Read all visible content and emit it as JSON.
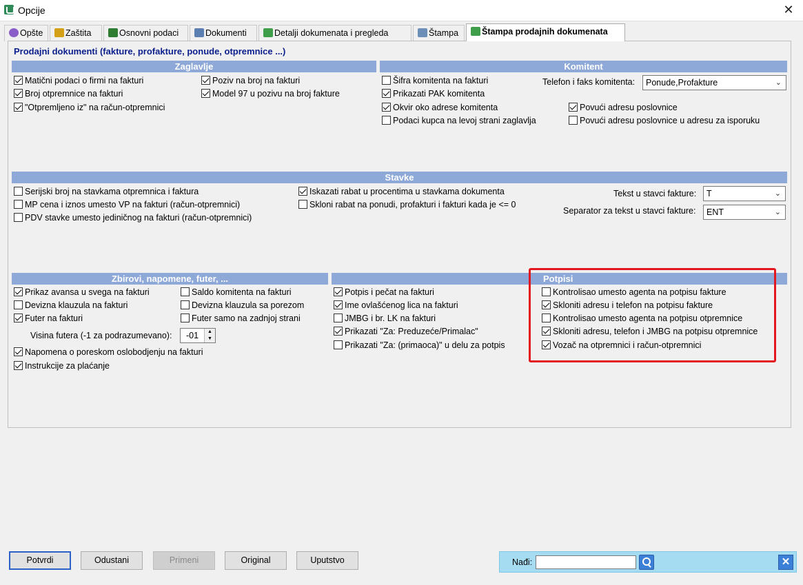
{
  "window": {
    "title": "Opcije",
    "close": "✕"
  },
  "tabs": [
    {
      "label": "Opšte",
      "icon": "gear-icon",
      "color": "#8a5ec9"
    },
    {
      "label": "Zaštita",
      "icon": "lock-icon",
      "color": "#d4a017"
    },
    {
      "label": "Osnovni podaci",
      "icon": "book-icon",
      "color": "#2e7d32"
    },
    {
      "label": "Dokumenti",
      "icon": "document-icon",
      "color": "#5b7fb0"
    },
    {
      "label": "Detalji dokumenata i pregleda",
      "icon": "document-edit-icon",
      "color": "#3e9e4a"
    },
    {
      "label": "Štampa",
      "icon": "printer-icon",
      "color": "#6c8fb8"
    },
    {
      "label": "Štampa prodajnih dokumenata",
      "icon": "printer-icon",
      "color": "#3e9e4a"
    }
  ],
  "group_title": "Prodajni dokumenti (fakture, profakture, ponude, otpremnice ...)",
  "zaglavlje": {
    "header": "Zaglavlje",
    "items": [
      {
        "label": "Matični podaci o firmi na fakturi",
        "checked": true
      },
      {
        "label": "Broj otpremnice na fakturi",
        "checked": true
      },
      {
        "label": "\"Otpremljeno iz\" na račun-otpremnici",
        "checked": true
      },
      {
        "label": "Poziv na broj na fakturi",
        "checked": true
      },
      {
        "label": "Model 97 u pozivu na broj fakture",
        "checked": true
      }
    ]
  },
  "komitent": {
    "header": "Komitent",
    "items": [
      {
        "label": "Šifra komitenta na fakturi",
        "checked": false
      },
      {
        "label": "Prikazati PAK komitenta",
        "checked": true
      },
      {
        "label": "Okvir oko adrese komitenta",
        "checked": true
      },
      {
        "label": "Podaci kupca na levoj strani zaglavlja",
        "checked": false
      },
      {
        "label": "Povući adresu poslovnice",
        "checked": true
      },
      {
        "label": "Povući adresu poslovnice u adresu za isporuku",
        "checked": false
      }
    ],
    "phone_label": "Telefon i faks komitenta:",
    "phone_value": "Ponude,Profakture"
  },
  "stavke": {
    "header": "Stavke",
    "items": [
      {
        "label": "Serijski broj na stavkama otpremnica i faktura",
        "checked": false
      },
      {
        "label": "MP cena i iznos umesto VP na fakturi (račun-otpremnici)",
        "checked": false
      },
      {
        "label": "PDV stavke umesto jediničnog na fakturi (račun-otpremnici)",
        "checked": false
      },
      {
        "label": "Iskazati rabat u procentima u stavkama dokumenta",
        "checked": true
      },
      {
        "label": "Skloni rabat na ponudi, profakturi i fakturi kada je <= 0",
        "checked": false
      }
    ],
    "text_label": "Tekst u stavci fakture:",
    "text_value": "T",
    "separator_label": "Separator za tekst u stavci fakture:",
    "separator_value": "ENT"
  },
  "zbirovi": {
    "header": "Zbirovi, napomene, futer, ...",
    "items": [
      {
        "label": "Prikaz avansa u svega na fakturi",
        "checked": true
      },
      {
        "label": "Devizna klauzula na fakturi",
        "checked": false
      },
      {
        "label": "Futer na fakturi",
        "checked": true
      },
      {
        "label": "Saldo komitenta na fakturi",
        "checked": false
      },
      {
        "label": "Devizna klauzula sa porezom",
        "checked": false
      },
      {
        "label": "Futer samo na zadnjoj strani",
        "checked": false
      },
      {
        "label": "Napomena o poreskom oslobodjenju na fakturi",
        "checked": true
      },
      {
        "label": "Instrukcije za plaćanje",
        "checked": true
      }
    ],
    "footer_height_label": "Visina futera (-1 za podrazumevano):",
    "footer_height_value": "-01"
  },
  "middle": {
    "items": [
      {
        "label": "Potpis i pečat na fakturi",
        "checked": true
      },
      {
        "label": "Ime ovlašćenog lica na fakturi",
        "checked": true
      },
      {
        "label": "JMBG i br. LK na fakturi",
        "checked": false
      },
      {
        "label": "Prikazati \"Za: Preduzeće/Primalac\"",
        "checked": true
      },
      {
        "label": "Prikazati \"Za: (primaoca)\" u delu za potpis",
        "checked": false
      }
    ]
  },
  "potpisi": {
    "header": "Potpisi",
    "items": [
      {
        "label": "Kontrolisao umesto agenta na potpisu fakture",
        "checked": false
      },
      {
        "label": "Skloniti adresu i telefon na potpisu fakture",
        "checked": true
      },
      {
        "label": "Kontrolisao umesto agenta na potpisu otpremnice",
        "checked": false
      },
      {
        "label": "Skloniti adresu, telefon i JMBG na potpisu otpremnice",
        "checked": true
      },
      {
        "label": "Vozač na otpremnici i račun-otpremnici",
        "checked": true
      }
    ]
  },
  "buttons": {
    "confirm": "Potvrdi",
    "cancel": "Odustani",
    "apply": "Primeni",
    "original": "Original",
    "help": "Uputstvo"
  },
  "find": {
    "label": "Nađi:",
    "value": "",
    "close": "✕"
  },
  "colors": {
    "section_header": "#8ea9d8",
    "group_title": "#0b1f8c",
    "highlight": "#e3171f",
    "find_bar": "#a6dcf2"
  }
}
